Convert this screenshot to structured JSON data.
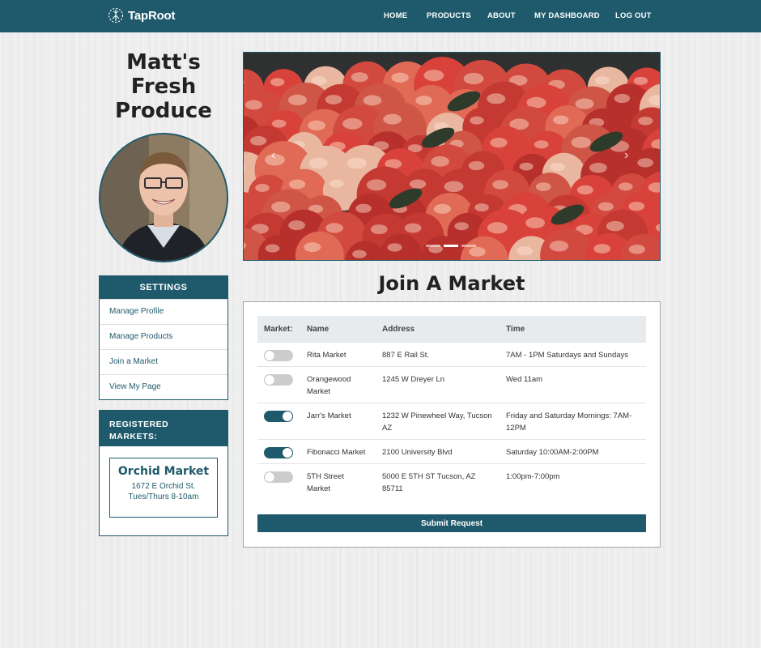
{
  "brand": {
    "name": "TapRoot"
  },
  "nav": [
    {
      "label": "HOME"
    },
    {
      "label": "PRODUCTS"
    },
    {
      "label": "ABOUT"
    },
    {
      "label": "MY DASHBOARD"
    },
    {
      "label": "LOG OUT"
    }
  ],
  "vendor": {
    "name": "Matt's Fresh Produce"
  },
  "settings": {
    "title": "SETTINGS",
    "items": [
      {
        "label": "Manage Profile"
      },
      {
        "label": "Manage Products"
      },
      {
        "label": "Join a Market"
      },
      {
        "label": "View My Page"
      }
    ]
  },
  "registered": {
    "title": "REGISTERED MARKETS:",
    "markets": [
      {
        "name": "Orchid Market",
        "address": "1672 E Orchid St.",
        "schedule": "Tues/Thurs 8-10am"
      }
    ]
  },
  "carousel": {
    "slide_count": 3,
    "active_index": 1
  },
  "join": {
    "title": "Join A Market",
    "columns": [
      "Market:",
      "Name",
      "Address",
      "Time"
    ],
    "rows": [
      {
        "joined": false,
        "name": "Rita Market",
        "address": "887 E Rail St.",
        "time": "7AM - 1PM Saturdays and Sundays"
      },
      {
        "joined": false,
        "name": "Orangewood Market",
        "address": "1245 W Dreyer Ln",
        "time": "Wed 11am"
      },
      {
        "joined": true,
        "name": "Jarr's Market",
        "address": "1232 W Pinewheel Way, Tucson AZ",
        "time": "Friday and Saturday Mornings: 7AM-12PM"
      },
      {
        "joined": true,
        "name": "Fibonacci Market",
        "address": "2100 University Blvd",
        "time": "Saturday 10:00AM-2:00PM"
      },
      {
        "joined": false,
        "name": "5TH Street Market",
        "address": "5000 E 5TH ST Tucson, AZ 85711",
        "time": "1:00pm-7:00pm"
      }
    ],
    "submit_label": "Submit Request"
  },
  "colors": {
    "primary": "#1e5a6b",
    "header_bg": "#e8ebed"
  }
}
